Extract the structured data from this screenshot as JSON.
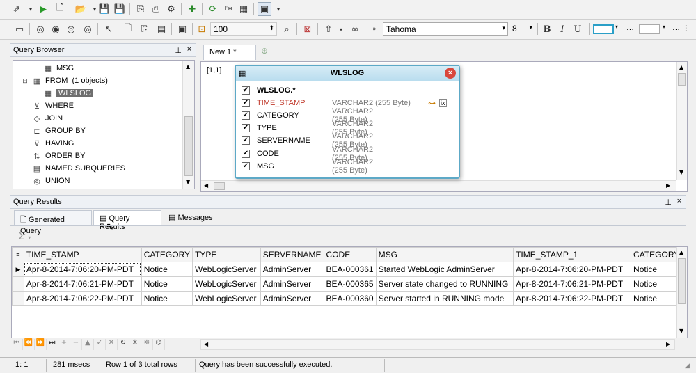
{
  "toolbar2": {
    "zoom_value": "100",
    "font_name": "Tahoma",
    "font_size": "8"
  },
  "query_browser": {
    "title": "Query Browser",
    "tree": [
      {
        "label": "MSG",
        "icon": "table-icon"
      },
      {
        "label": "FROM",
        "extra": "(1 objects)",
        "icon": "table-icon"
      },
      {
        "label": "WLSLOG",
        "icon": "table-icon",
        "selected": true
      },
      {
        "label": "WHERE",
        "icon": "filter-icon"
      },
      {
        "label": "JOIN",
        "icon": "diamond-icon"
      },
      {
        "label": "GROUP BY",
        "icon": "group-icon"
      },
      {
        "label": "HAVING",
        "icon": "filter-icon"
      },
      {
        "label": "ORDER BY",
        "icon": "sort-icon"
      },
      {
        "label": "NAMED SUBQUERIES",
        "icon": "subquery-icon"
      },
      {
        "label": "UNION",
        "icon": "union-icon"
      }
    ]
  },
  "editor": {
    "tab_label": "New 1 *",
    "cursor_pos": "[1,1]",
    "table_window": {
      "title": "WLSLOG",
      "all_columns": "WLSLOG.*",
      "columns": [
        {
          "name": "TIME_STAMP",
          "type": "VARCHAR2 (255 Byte)",
          "key": true
        },
        {
          "name": "CATEGORY",
          "type": "VARCHAR2 (255 Byte)"
        },
        {
          "name": "TYPE",
          "type": "VARCHAR2 (255 Byte)"
        },
        {
          "name": "SERVERNAME",
          "type": "VARCHAR2 (255 Byte)"
        },
        {
          "name": "CODE",
          "type": "VARCHAR2 (255 Byte)"
        },
        {
          "name": "MSG",
          "type": "VARCHAR2 (255 Byte)"
        }
      ]
    }
  },
  "results": {
    "title": "Query Results",
    "tabs": [
      "Generated Query",
      "Query Results",
      "Messages"
    ],
    "sum_symbol": "Σ",
    "columns": [
      "TIME_STAMP",
      "CATEGORY",
      "TYPE",
      "SERVERNAME",
      "CODE",
      "MSG",
      "TIME_STAMP_1",
      "CATEGORY_"
    ],
    "rows": [
      [
        "Apr-8-2014-7:06:20-PM-PDT",
        "Notice",
        "WebLogicServer",
        "AdminServer",
        "BEA-000361",
        "Started WebLogic AdminServer",
        "Apr-8-2014-7:06:20-PM-PDT",
        "Notice"
      ],
      [
        "Apr-8-2014-7:06:21-PM-PDT",
        "Notice",
        "WebLogicServer",
        "AdminServer",
        "BEA-000365",
        "Server state changed to RUNNING",
        "Apr-8-2014-7:06:21-PM-PDT",
        "Notice"
      ],
      [
        "Apr-8-2014-7:06:22-PM-PDT",
        "Notice",
        "WebLogicServer",
        "AdminServer",
        "BEA-000360",
        "Server started in RUNNING mode",
        "Apr-8-2014-7:06:22-PM-PDT",
        "Notice"
      ]
    ]
  },
  "status": {
    "position": "1:   1",
    "time": "281 msecs",
    "row_info": "Row 1 of 3 total rows",
    "message": "Query has been successfully executed."
  },
  "colors": {
    "accent": "#5da9c7",
    "key_column": "#c0392b"
  }
}
